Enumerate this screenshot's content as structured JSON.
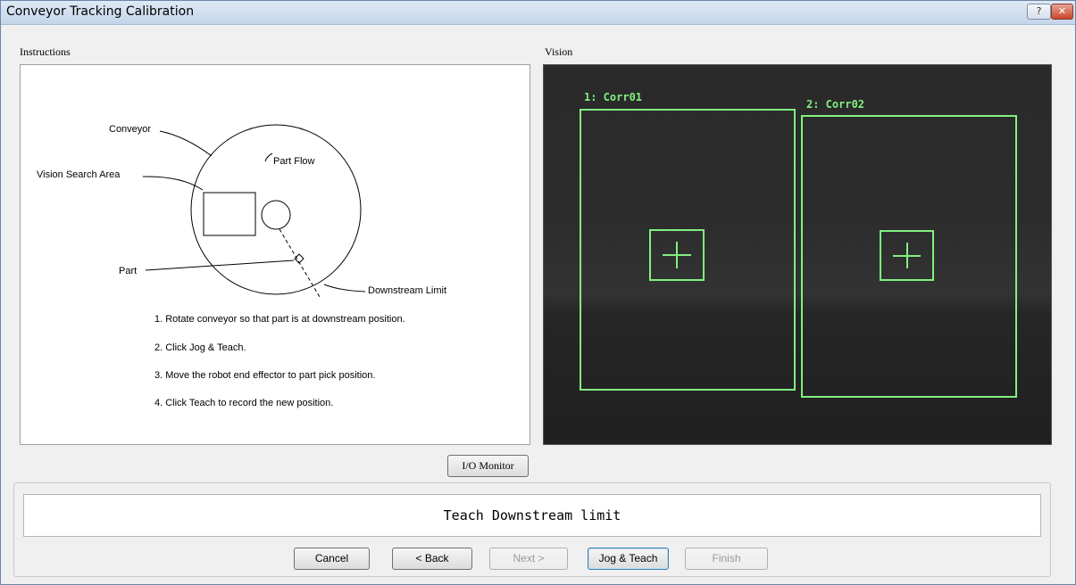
{
  "window": {
    "title": "Conveyor Tracking Calibration",
    "help_label": "?",
    "close_label": "✕"
  },
  "instructions": {
    "label": "Instructions",
    "diagram": {
      "conveyor": "Conveyor",
      "part_flow": "Part Flow",
      "vision_search_area": "Vision Search Area",
      "part": "Part",
      "downstream_limit": "Downstream Limit"
    },
    "steps": [
      "1. Rotate conveyor so that part is at downstream position.",
      "2. Click Jog & Teach.",
      "3. Move the robot end effector to part pick position.",
      "4. Click Teach to record the new position."
    ]
  },
  "vision": {
    "label": "Vision",
    "rois": [
      {
        "label": "1: Corr01"
      },
      {
        "label": "2: Corr02"
      }
    ],
    "overlay_color": "#80f080"
  },
  "io_monitor_label": "I/O Monitor",
  "status": {
    "message": "Teach Downstream limit"
  },
  "buttons": {
    "cancel": "Cancel",
    "back": "< Back",
    "next": "Next >",
    "jog_teach": "Jog & Teach",
    "finish": "Finish"
  }
}
